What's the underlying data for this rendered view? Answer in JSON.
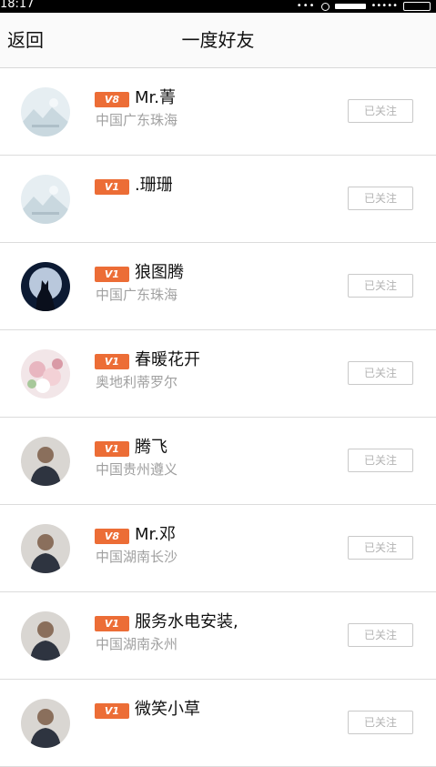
{
  "status_bar": {
    "time": "18:17",
    "more": "•••",
    "signal_dots": "•••••"
  },
  "header": {
    "back_label": "返回",
    "title": "一度好友"
  },
  "friends": [
    {
      "level": "V8",
      "name": "Mr.菁",
      "location": "中国广东珠海",
      "follow_label": "已关注",
      "avatar": "placeholder-landscape"
    },
    {
      "level": "V1",
      "name": ".珊珊",
      "location": "",
      "follow_label": "已关注",
      "avatar": "placeholder-landscape"
    },
    {
      "level": "V1",
      "name": "狼图腾",
      "location": "中国广东珠海",
      "follow_label": "已关注",
      "avatar": "wolf-moon"
    },
    {
      "level": "V1",
      "name": "春暖花开",
      "location": "奥地利蒂罗尔",
      "follow_label": "已关注",
      "avatar": "flowers"
    },
    {
      "level": "V1",
      "name": "腾飞",
      "location": "中国贵州遵义",
      "follow_label": "已关注",
      "avatar": "person-photo"
    },
    {
      "level": "V8",
      "name": "Mr.邓",
      "location": "中国湖南长沙",
      "follow_label": "已关注",
      "avatar": "person-photo"
    },
    {
      "level": "V1",
      "name": "服务水电安装,",
      "location": "中国湖南永州",
      "follow_label": "已关注",
      "avatar": "person-photo"
    },
    {
      "level": "V1",
      "name": "微笑小草",
      "location": "",
      "follow_label": "已关注",
      "avatar": "person-photo"
    }
  ],
  "colors": {
    "badge": "#ec6d36",
    "follow_border": "#c9c9c9"
  }
}
